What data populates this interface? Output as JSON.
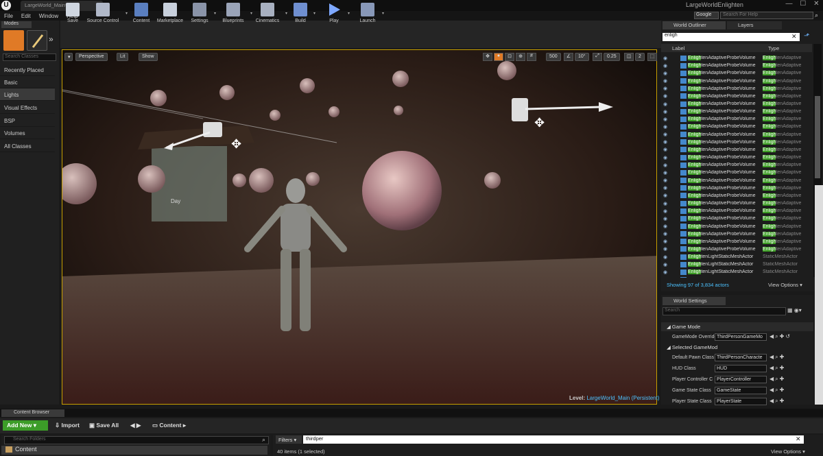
{
  "titlebar": {
    "tab": "LargeWorld_Main*",
    "app_title": "LargeWorldEnlighten",
    "min": "—",
    "max": "☐",
    "close": "✕"
  },
  "menu": [
    "File",
    "Edit",
    "Window",
    "Help"
  ],
  "help": {
    "provider": "Google",
    "search_placeholder": "Search For Help"
  },
  "modes": {
    "tab": "Modes",
    "search_placeholder": "Search Classes",
    "categories": [
      "Recently Placed",
      "Basic",
      "Lights",
      "Visual Effects",
      "BSP",
      "Volumes",
      "All Classes"
    ],
    "selected": 2
  },
  "toolbar": [
    "Save",
    "Source Control",
    "Content",
    "Marketplace",
    "Settings",
    "Blueprints",
    "Cinematics",
    "Build",
    "Play",
    "Launch"
  ],
  "viewport": {
    "perspective": "Perspective",
    "lit": "Lit",
    "show": "Show",
    "grid": "500",
    "angle": "10°",
    "scale": "0.25",
    "cam": "2",
    "level_label": "Level:",
    "level_name": "LargeWorld_Main (Persistent)",
    "scene_texts": [
      "Day"
    ]
  },
  "outliner": {
    "tabs": [
      "World Outliner",
      "Layers"
    ],
    "search": "enligh",
    "col_label": "Label",
    "col_type": "Type",
    "rows": [
      {
        "hl": "Enligh",
        "rest": "tenAdaptiveProbeVolume",
        "thl": "Enligh",
        "trest": "tenAdaptive"
      },
      {
        "hl": "Enligh",
        "rest": "tenAdaptiveProbeVolume",
        "thl": "Enligh",
        "trest": "tenAdaptive"
      },
      {
        "hl": "Enligh",
        "rest": "tenAdaptiveProbeVolume",
        "thl": "Enligh",
        "trest": "tenAdaptive"
      },
      {
        "hl": "Enligh",
        "rest": "tenAdaptiveProbeVolume",
        "thl": "Enligh",
        "trest": "tenAdaptive"
      },
      {
        "hl": "Enligh",
        "rest": "tenAdaptiveProbeVolume",
        "thl": "Enligh",
        "trest": "tenAdaptive"
      },
      {
        "hl": "Enligh",
        "rest": "tenAdaptiveProbeVolume",
        "thl": "Enligh",
        "trest": "tenAdaptive"
      },
      {
        "hl": "Enligh",
        "rest": "tenAdaptiveProbeVolume",
        "thl": "Enligh",
        "trest": "tenAdaptive"
      },
      {
        "hl": "Enligh",
        "rest": "tenAdaptiveProbeVolume",
        "thl": "Enligh",
        "trest": "tenAdaptive"
      },
      {
        "hl": "Enligh",
        "rest": "tenAdaptiveProbeVolume",
        "thl": "Enligh",
        "trest": "tenAdaptive"
      },
      {
        "hl": "Enligh",
        "rest": "tenAdaptiveProbeVolume",
        "thl": "Enligh",
        "trest": "tenAdaptive"
      },
      {
        "hl": "Enligh",
        "rest": "tenAdaptiveProbeVolume",
        "thl": "Enligh",
        "trest": "tenAdaptive"
      },
      {
        "hl": "Enligh",
        "rest": "tenAdaptiveProbeVolume",
        "thl": "Enligh",
        "trest": "tenAdaptive"
      },
      {
        "hl": "Enligh",
        "rest": "tenAdaptiveProbeVolume",
        "thl": "Enligh",
        "trest": "tenAdaptive"
      },
      {
        "hl": "Enligh",
        "rest": "tenAdaptiveProbeVolume",
        "thl": "Enligh",
        "trest": "tenAdaptive"
      },
      {
        "hl": "Enligh",
        "rest": "tenAdaptiveProbeVolume",
        "thl": "Enligh",
        "trest": "tenAdaptive"
      },
      {
        "hl": "Enligh",
        "rest": "tenAdaptiveProbeVolume",
        "thl": "Enligh",
        "trest": "tenAdaptive"
      },
      {
        "hl": "Enligh",
        "rest": "tenAdaptiveProbeVolume",
        "thl": "Enligh",
        "trest": "tenAdaptive"
      },
      {
        "hl": "Enligh",
        "rest": "tenAdaptiveProbeVolume",
        "thl": "Enligh",
        "trest": "tenAdaptive"
      },
      {
        "hl": "Enligh",
        "rest": "tenAdaptiveProbeVolume",
        "thl": "Enligh",
        "trest": "tenAdaptive"
      },
      {
        "hl": "Enligh",
        "rest": "tenAdaptiveProbeVolume",
        "thl": "Enligh",
        "trest": "tenAdaptive"
      },
      {
        "hl": "Enligh",
        "rest": "tenAdaptiveProbeVolume",
        "thl": "Enligh",
        "trest": "tenAdaptive"
      },
      {
        "hl": "Enligh",
        "rest": "tenAdaptiveProbeVolume",
        "thl": "Enligh",
        "trest": "tenAdaptive"
      },
      {
        "hl": "Enligh",
        "rest": "tenAdaptiveProbeVolume",
        "thl": "Enligh",
        "trest": "tenAdaptive"
      },
      {
        "hl": "Enligh",
        "rest": "tenAdaptiveProbeVolume",
        "thl": "Enligh",
        "trest": "tenAdaptive"
      },
      {
        "hl": "Enligh",
        "rest": "tenAdaptiveProbeVolume",
        "thl": "Enligh",
        "trest": "tenAdaptive"
      },
      {
        "hl": "Enligh",
        "rest": "tenAdaptiveProbeVolume",
        "thl": "Enligh",
        "trest": "tenAdaptive"
      },
      {
        "hl": "Enligh",
        "rest": "tenLightStaticMeshActor",
        "thl": "",
        "trest": "StaticMeshActor"
      },
      {
        "hl": "Enligh",
        "rest": "tenLightStaticMeshActor",
        "thl": "",
        "trest": "StaticMeshActor"
      },
      {
        "hl": "Enligh",
        "rest": "tenLightStaticMeshActor",
        "thl": "",
        "trest": "StaticMeshActor"
      },
      {
        "hl": "Enligh",
        "rest": "tenLightStaticMeshActor",
        "thl": "",
        "trest": "StaticMeshActor"
      }
    ],
    "status": "Showing 97 of 3,834 actors",
    "view_options": "View Options ▾"
  },
  "world_settings": {
    "tab": "World Settings",
    "search_placeholder": "Search",
    "section_game_mode": "Game Mode",
    "gm_override_label": "GameMode Override",
    "gm_override_value": "ThirdPersonGameMo",
    "section_selected": "Selected GameMod",
    "props": [
      {
        "label": "Default Pawn Class",
        "value": "ThirdPersonCharacte"
      },
      {
        "label": "HUD Class",
        "value": "HUD"
      },
      {
        "label": "Player Controller C",
        "value": "PlayerController"
      },
      {
        "label": "Game State Class",
        "value": "GameState"
      },
      {
        "label": "Player State Class",
        "value": "PlayerState"
      }
    ]
  },
  "content_browser": {
    "tab": "Content Browser",
    "add_new": "Add New ▾",
    "import": "Import",
    "save_all": "Save All",
    "path": "Content",
    "folder_search": "Search Folders",
    "folder": "Content",
    "filters": "Filters ▾",
    "asset_search": "thirdper",
    "count": "40 items (1 selected)",
    "view_options": "View Options ▾"
  },
  "colors": {
    "accent_green": "#3c9c28",
    "highlight_green": "#3a9c22",
    "selection_yellow": "#c8a000",
    "info_blue": "#4cc2ff"
  }
}
